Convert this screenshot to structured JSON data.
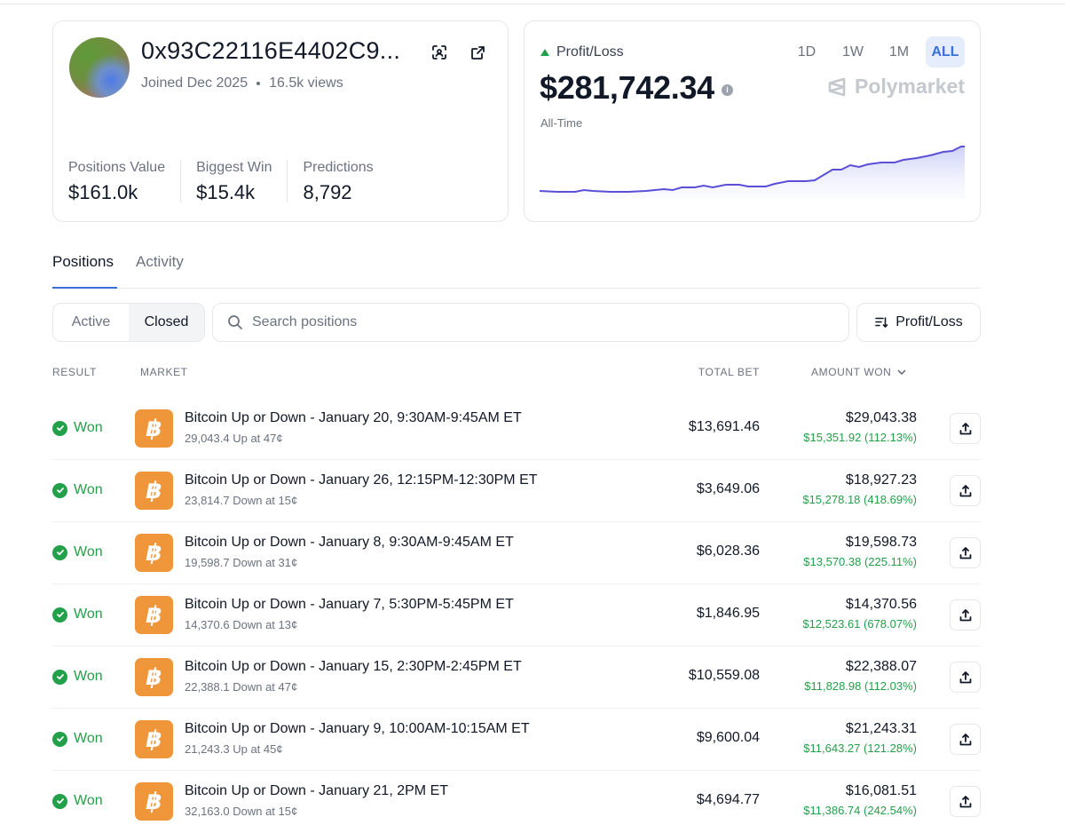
{
  "profile": {
    "address": "0x93C22116E4402C9...",
    "joined": "Joined Dec 2025",
    "views": "16.5k views",
    "stats": [
      {
        "label": "Positions Value",
        "value": "$161.0k"
      },
      {
        "label": "Biggest Win",
        "value": "$15.4k"
      },
      {
        "label": "Predictions",
        "value": "8,792"
      }
    ]
  },
  "pnl": {
    "label": "Profit/Loss",
    "value": "$281,742.34",
    "period_label": "All-Time",
    "ranges": [
      "1D",
      "1W",
      "1M",
      "ALL"
    ],
    "active_range": "ALL",
    "brand": "Polymarket",
    "colors": {
      "line": "#5b4fd6",
      "fill": "#d9dcfa",
      "up": "#22a04a"
    }
  },
  "tabs": {
    "positions": "Positions",
    "activity": "Activity"
  },
  "filters": {
    "active": "Active",
    "closed": "Closed",
    "selected": "Closed",
    "search_placeholder": "Search positions",
    "sort_label": "Profit/Loss"
  },
  "table": {
    "headers": {
      "result": "RESULT",
      "market": "MARKET",
      "total_bet": "TOTAL BET",
      "amount_won": "AMOUNT WON"
    },
    "rows": [
      {
        "result": "Won",
        "title": "Bitcoin Up or Down - January 20, 9:30AM-9:45AM ET",
        "sub": "29,043.4 Up at 47¢",
        "bet": "$13,691.46",
        "won": "$29,043.38",
        "delta": "$15,351.92 (112.13%)"
      },
      {
        "result": "Won",
        "title": "Bitcoin Up or Down - January 26, 12:15PM-12:30PM ET",
        "sub": "23,814.7 Down at 15¢",
        "bet": "$3,649.06",
        "won": "$18,927.23",
        "delta": "$15,278.18 (418.69%)"
      },
      {
        "result": "Won",
        "title": "Bitcoin Up or Down - January 8, 9:30AM-9:45AM ET",
        "sub": "19,598.7 Down at 31¢",
        "bet": "$6,028.36",
        "won": "$19,598.73",
        "delta": "$13,570.38 (225.11%)"
      },
      {
        "result": "Won",
        "title": "Bitcoin Up or Down - January 7, 5:30PM-5:45PM ET",
        "sub": "14,370.6 Down at 13¢",
        "bet": "$1,846.95",
        "won": "$14,370.56",
        "delta": "$12,523.61 (678.07%)"
      },
      {
        "result": "Won",
        "title": "Bitcoin Up or Down - January 15, 2:30PM-2:45PM ET",
        "sub": "22,388.1 Down at 47¢",
        "bet": "$10,559.08",
        "won": "$22,388.07",
        "delta": "$11,828.98 (112.03%)"
      },
      {
        "result": "Won",
        "title": "Bitcoin Up or Down - January 9, 10:00AM-10:15AM ET",
        "sub": "21,243.3 Up at 45¢",
        "bet": "$9,600.04",
        "won": "$21,243.31",
        "delta": "$11,643.27 (121.28%)"
      },
      {
        "result": "Won",
        "title": "Bitcoin Up or Down - January 21, 2PM ET",
        "sub": "32,163.0 Down at 15¢",
        "bet": "$4,694.77",
        "won": "$16,081.51",
        "delta": "$11,386.74 (242.54%)"
      }
    ]
  }
}
